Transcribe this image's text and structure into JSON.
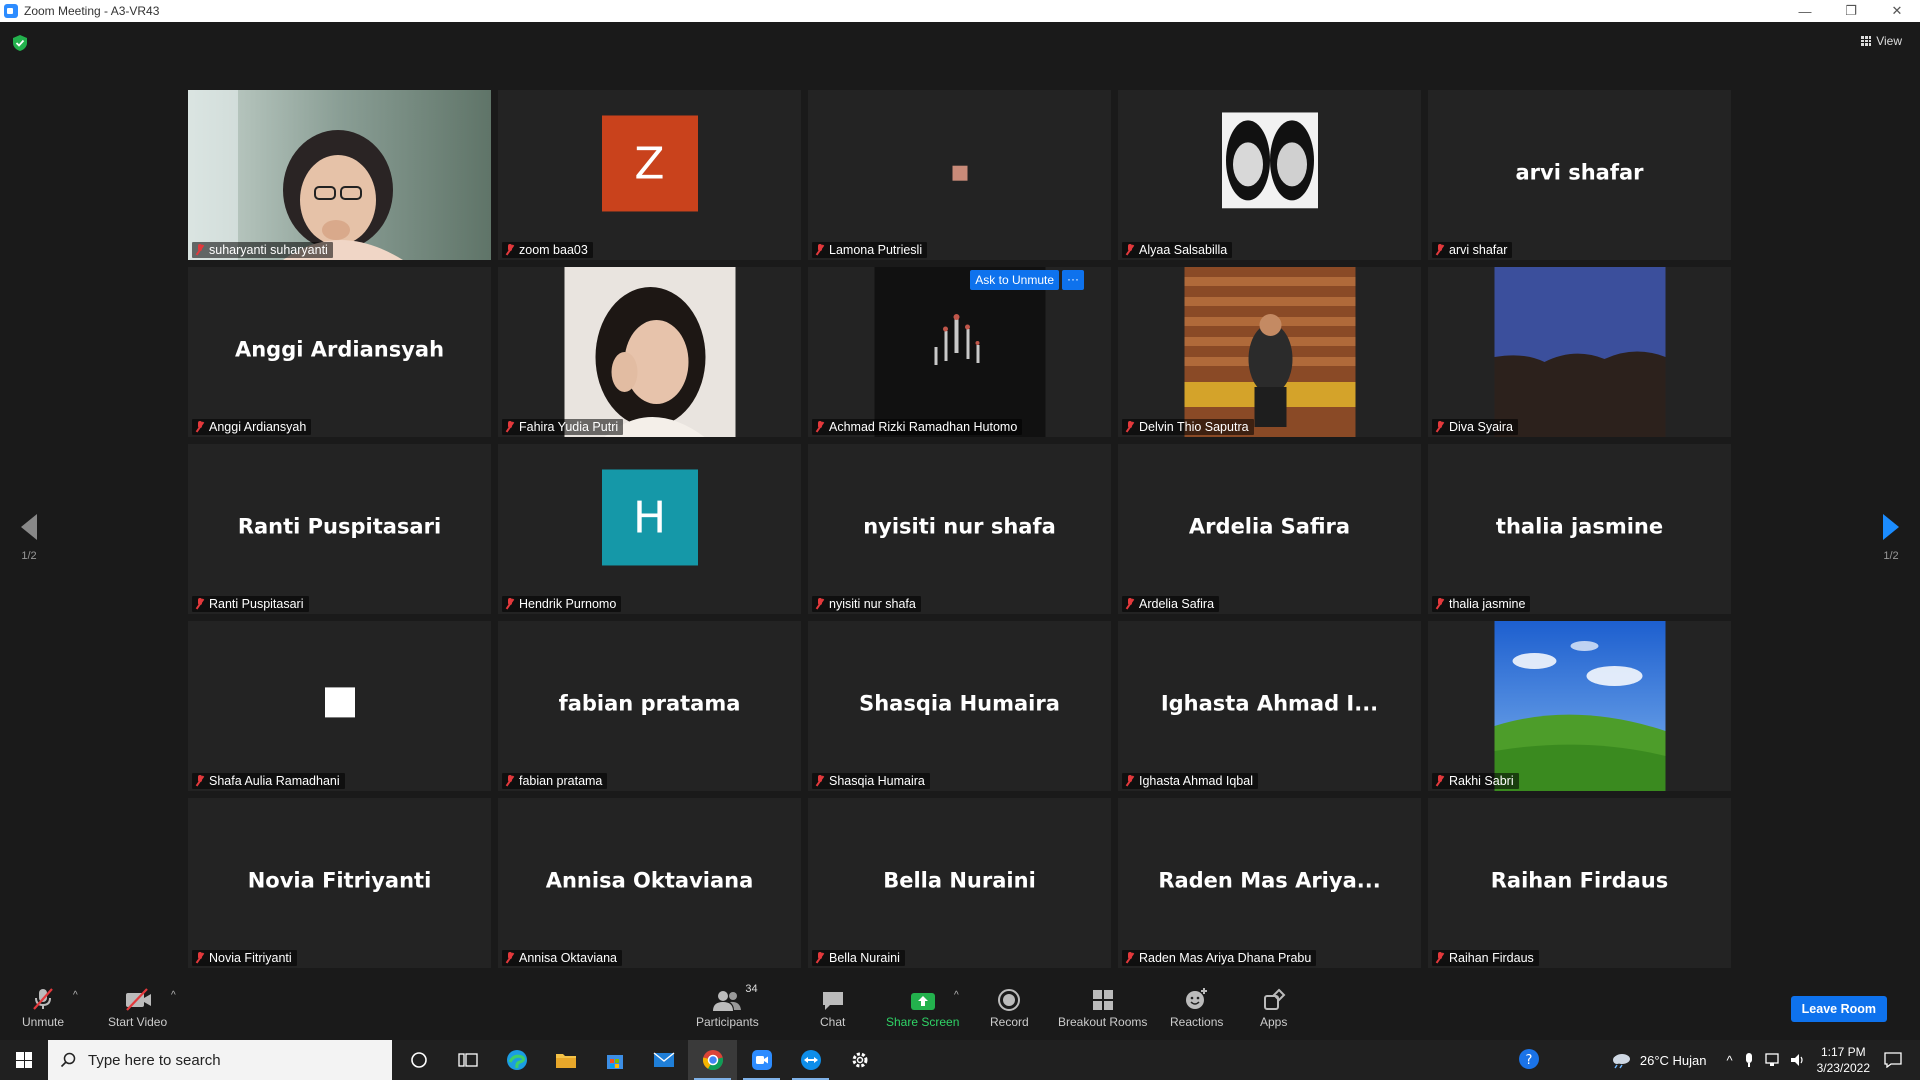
{
  "window": {
    "title": "Zoom Meeting - A3-VR43",
    "minimize": "—",
    "restore": "❐",
    "close": "✕"
  },
  "top": {
    "view_label": "View"
  },
  "pager": {
    "left_page": "1/2",
    "right_page": "1/2"
  },
  "tiles": [
    {
      "label": "suharyanti suharyanti",
      "big_name": "",
      "kind": "video",
      "active": true
    },
    {
      "label": "zoom baa03",
      "big_name": "",
      "kind": "letter",
      "letter": "Z",
      "color": "#c9421c"
    },
    {
      "label": "Lamona Putriesli",
      "big_name": "",
      "kind": "small-square",
      "color": "#c98b79"
    },
    {
      "label": "Alyaa Salsabilla",
      "big_name": "",
      "kind": "bw-photo"
    },
    {
      "label": "arvi shafar",
      "big_name": "arvi shafar",
      "kind": "name"
    },
    {
      "label": "Anggi Ardiansyah",
      "big_name": "Anggi Ardiansyah",
      "kind": "name"
    },
    {
      "label": "Fahira Yudia Putri",
      "big_name": "",
      "kind": "portrait"
    },
    {
      "label": "Achmad Rizki Ramadhan Hutomo",
      "big_name": "",
      "kind": "dark-art",
      "ask_unmute": "Ask to Unmute",
      "more": "···"
    },
    {
      "label": "Delvin Thio Saputra",
      "big_name": "",
      "kind": "wood-photo"
    },
    {
      "label": "Diva Syaira",
      "big_name": "",
      "kind": "sky-photo"
    },
    {
      "label": "Ranti Puspitasari",
      "big_name": "Ranti Puspitasari",
      "kind": "name"
    },
    {
      "label": "Hendrik Purnomo",
      "big_name": "",
      "kind": "letter",
      "letter": "H",
      "color": "#1598a8"
    },
    {
      "label": "nyisiti nur shafa",
      "big_name": "nyisiti nur shafa",
      "kind": "name"
    },
    {
      "label": "Ardelia Safira",
      "big_name": "Ardelia Safira",
      "kind": "name"
    },
    {
      "label": "thalia jasmine",
      "big_name": "thalia jasmine",
      "kind": "name"
    },
    {
      "label": "Shafa Aulia Ramadhani",
      "big_name": "",
      "kind": "white-square"
    },
    {
      "label": "fabian pratama",
      "big_name": "fabian pratama",
      "kind": "name"
    },
    {
      "label": "Shasqia Humaira",
      "big_name": "Shasqia Humaira",
      "kind": "name"
    },
    {
      "label": "Ighasta Ahmad Iqbal",
      "big_name": "Ighasta Ahmad I...",
      "kind": "name"
    },
    {
      "label": "Rakhi Sabri",
      "big_name": "",
      "kind": "bliss-photo"
    },
    {
      "label": "Novia Fitriyanti",
      "big_name": "Novia Fitriyanti",
      "kind": "name"
    },
    {
      "label": "Annisa Oktaviana",
      "big_name": "Annisa Oktaviana",
      "kind": "name"
    },
    {
      "label": "Bella Nuraini",
      "big_name": "Bella Nuraini",
      "kind": "name"
    },
    {
      "label": "Raden Mas Ariya Dhana Prabu",
      "big_name": "Raden Mas Ariya...",
      "kind": "name"
    },
    {
      "label": "Raihan Firdaus",
      "big_name": "Raihan Firdaus",
      "kind": "name"
    }
  ],
  "toolbar": {
    "unmute": "Unmute",
    "start_video": "Start Video",
    "participants": "Participants",
    "participants_count": "34",
    "chat": "Chat",
    "share_screen": "Share Screen",
    "record": "Record",
    "breakout_rooms": "Breakout Rooms",
    "reactions": "Reactions",
    "apps": "Apps",
    "leave_room": "Leave Room"
  },
  "taskbar": {
    "search_placeholder": "Type here to search",
    "weather": "26°C  Hujan",
    "time": "1:17 PM",
    "date": "3/23/2022"
  }
}
